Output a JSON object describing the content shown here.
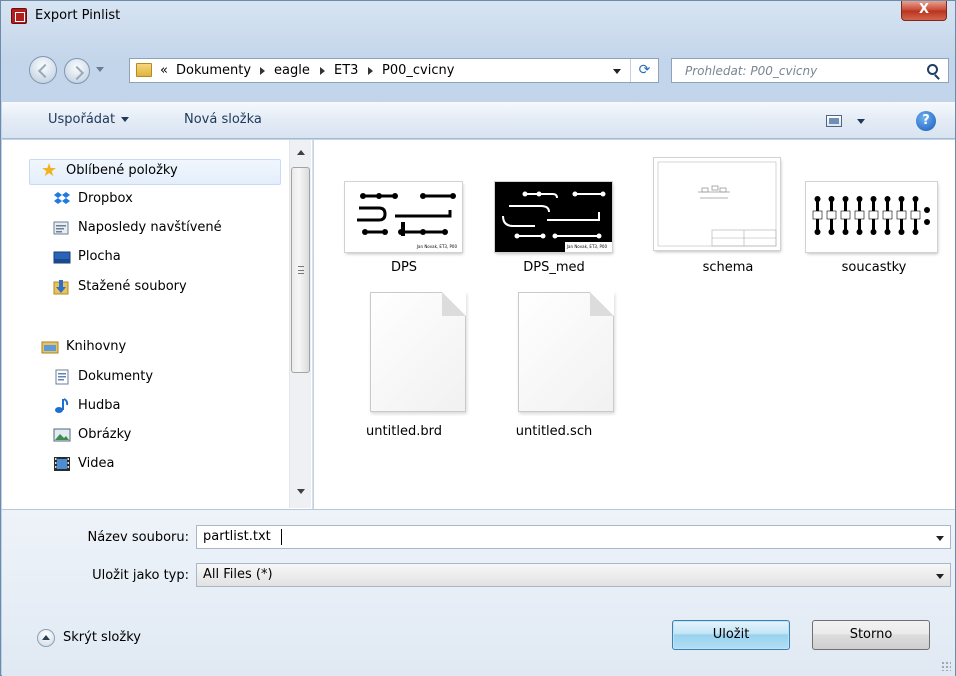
{
  "window": {
    "title": "Export Pinlist",
    "close_glyph": "X"
  },
  "address": {
    "overflow": "«",
    "crumbs": [
      "Dokumenty",
      "eagle",
      "ET3",
      "P00_cvicny"
    ],
    "search_placeholder": "Prohledat: P00_cvicny"
  },
  "toolbar": {
    "organize_label": "Uspořádat",
    "new_folder_label": "Nová složka",
    "help_glyph": "?"
  },
  "nav": {
    "favorites_label": "Oblíbené položky",
    "favorites": [
      "Dropbox",
      "Naposledy navštívené",
      "Plocha",
      "Stažené soubory"
    ],
    "libraries_label": "Knihovny",
    "libraries": [
      "Dokumenty",
      "Hudba",
      "Obrázky",
      "Videa"
    ]
  },
  "files": [
    {
      "name": "DPS",
      "type": "board-light",
      "footer": "Jan Novak, ET3, P00"
    },
    {
      "name": "DPS_med",
      "type": "board-dark",
      "footer": "Jan Novak, ET3, P00"
    },
    {
      "name": "schema",
      "type": "schematic"
    },
    {
      "name": "soucastky",
      "type": "parts"
    },
    {
      "name": "untitled.brd",
      "type": "document"
    },
    {
      "name": "untitled.sch",
      "type": "document"
    }
  ],
  "form": {
    "filename_label": "Název souboru:",
    "filename_value": "partlist.txt",
    "filetype_label": "Uložit jako typ:",
    "filetype_value": "All Files (*)"
  },
  "footer": {
    "hide_folders_label": "Skrýt složky",
    "save_label": "Uložit",
    "cancel_label": "Storno"
  },
  "colors": {
    "accent": "#3c7fb1",
    "board_dark": "#000000",
    "window_frame": "#c3d5ea"
  }
}
